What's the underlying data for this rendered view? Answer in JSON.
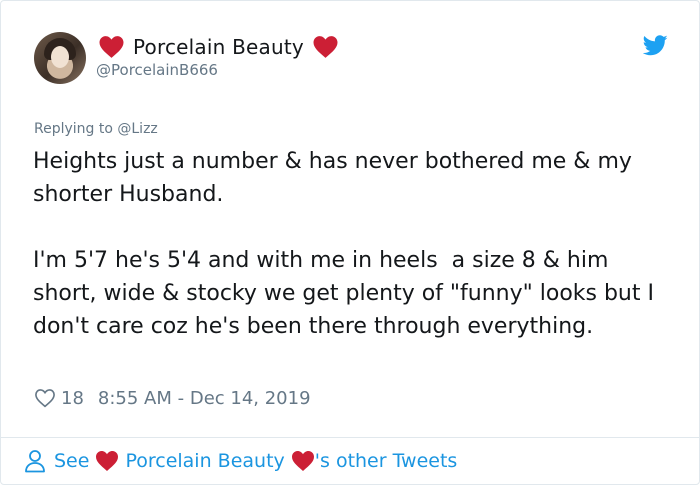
{
  "author": {
    "display_name": "Porcelain Beauty",
    "handle": "@PorcelainB666"
  },
  "reply": {
    "label": "Replying to @Lizz"
  },
  "tweet": {
    "paragraph_1": "Heights just a number & has never bothered me & my shorter Husband.",
    "paragraph_2": "I'm 5'7 he's 5'4 and with me in heels  a size 8 & him short, wide & stocky we get plenty of \"funny\" looks but I don't care coz he's been there through everything."
  },
  "meta": {
    "like_count": "18",
    "timestamp": "8:55 AM - Dec 14, 2019"
  },
  "footer": {
    "see_label": "See",
    "name": "Porcelain Beauty",
    "suffix": "'s other Tweets"
  },
  "icons": {
    "heart_emoji": "heart-icon",
    "twitter": "twitter-bird-icon",
    "like": "like-heart-outline-icon",
    "person": "person-icon"
  },
  "colors": {
    "heart_red": "#cc1f35",
    "twitter_blue": "#1da1f2",
    "link_blue": "#1b95e0",
    "text": "#14171a",
    "muted": "#657786"
  }
}
